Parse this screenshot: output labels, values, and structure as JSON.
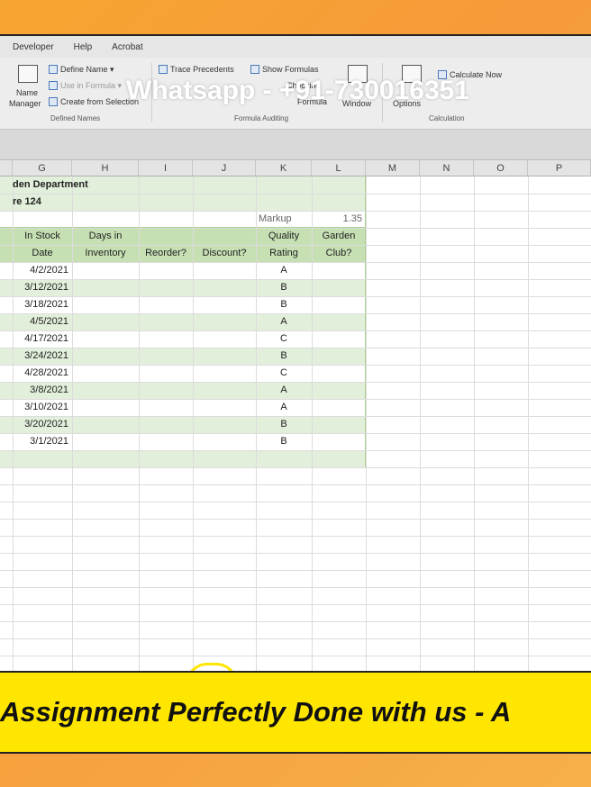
{
  "menu": [
    "Developer",
    "Help",
    "Acrobat"
  ],
  "ribbon": {
    "name_manager": "Name",
    "name_manager_2": "Manager",
    "define_name": "Define Name",
    "use_in_formula": "Use in Formula",
    "create_from_selection": "Create from Selection",
    "defined_names_group": "Defined Names",
    "trace_precedents": "Trace Precedents",
    "show_formulas": "Show Formulas",
    "watch_window": "Window",
    "formula_frag": "Formula",
    "checking_frag": "Checking",
    "formula_auditing_group": "Formula Auditing",
    "calculate_now": "Calculate Now",
    "options_frag": "Options",
    "calculation_group": "Calculation"
  },
  "watermark": "Whatsapp - +91-730016351",
  "columns": [
    "G",
    "H",
    "I",
    "J",
    "K",
    "L",
    "M",
    "N",
    "O",
    "P"
  ],
  "sheet": {
    "title1": "den Department",
    "title2": "re 124",
    "markup_label": "Markup",
    "markup_value": "1.35",
    "headers": {
      "g1": "In Stock",
      "g2": "Date",
      "h1": "Days in",
      "h2": "Inventory",
      "i2": "Reorder?",
      "j2": "Discount?",
      "k1": "Quality",
      "k2": "Rating",
      "l1": "Garden",
      "l2": "Club?"
    },
    "rows": [
      {
        "date": "4/2/2021",
        "rating": "A"
      },
      {
        "date": "3/12/2021",
        "rating": "B"
      },
      {
        "date": "3/18/2021",
        "rating": "B"
      },
      {
        "date": "4/5/2021",
        "rating": "A"
      },
      {
        "date": "4/17/2021",
        "rating": "C"
      },
      {
        "date": "3/24/2021",
        "rating": "B"
      },
      {
        "date": "4/28/2021",
        "rating": "C"
      },
      {
        "date": "3/8/2021",
        "rating": "A"
      },
      {
        "date": "3/10/2021",
        "rating": "A"
      },
      {
        "date": "3/20/2021",
        "rating": "B"
      },
      {
        "date": "3/1/2021",
        "rating": "B"
      }
    ]
  },
  "footer": "Assignment Perfectly Done with us  - A",
  "colors": {
    "green_light": "#e2efda",
    "green_header": "#c6e0b4",
    "banner": "#ffe600"
  }
}
